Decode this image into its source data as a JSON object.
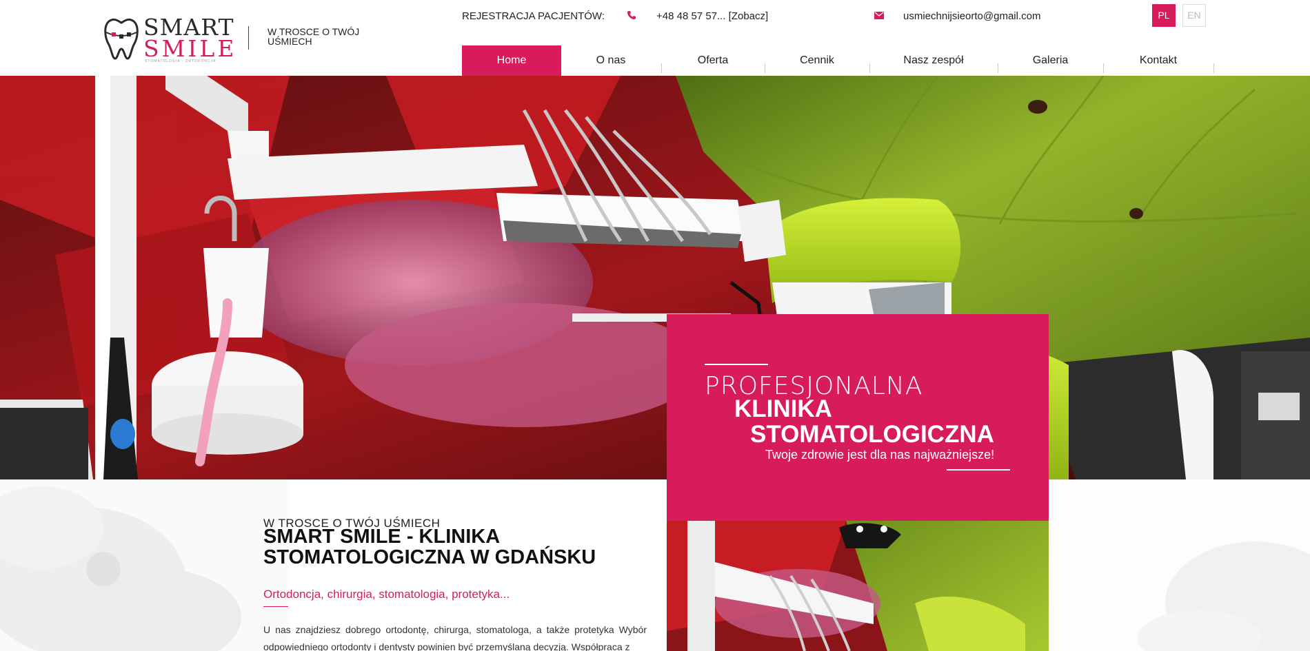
{
  "header": {
    "logo": {
      "line1": "SMART",
      "line2": "SMILE",
      "sub": "STOMATOLOGIA · ORTODONCJA"
    },
    "tagline": "W TROSCE O TWÓJ UŚMIECH",
    "registration_label": "REJESTRACJA PACJENTÓW:",
    "phone": "+48 48 57 57... [Zobacz]",
    "email": "usmiechnijsieorto@gmail.com",
    "languages": [
      {
        "label": "PL",
        "active": true
      },
      {
        "label": "EN",
        "active": false
      }
    ]
  },
  "nav": {
    "items": [
      {
        "label": "Home",
        "active": true
      },
      {
        "label": "O nas"
      },
      {
        "label": "Oferta"
      },
      {
        "label": "Cennik"
      },
      {
        "label": "Nasz zespół"
      },
      {
        "label": "Galeria"
      },
      {
        "label": "Kontakt"
      }
    ]
  },
  "hero": {
    "line1": "PROFESJONALNA",
    "line2": "KLINIKA",
    "line3": "STOMATOLOGICZNA",
    "subtitle": "Twoje zdrowie jest dla nas najważniejsze!"
  },
  "about": {
    "kicker": "W TROSCE O TWÓJ UŚMIECH",
    "heading": "SMART SMILE - KLINIKA STOMATOLOGICZNA W GDAŃSKU",
    "subheading": "Ortodoncja, chirurgia, stomatologia, protetyka...",
    "body": "U nas znajdziesz dobrego ortodontę, chirurga, stomatologa, a także protetyka Wybór odpowiedniego ortodonty i dentysty powinien być przemyślaną decyzją. Współpraca z"
  },
  "colors": {
    "accent": "#d81b5c",
    "text": "#222222"
  },
  "icons": {
    "phone": "phone-icon",
    "mail": "mail-icon"
  }
}
